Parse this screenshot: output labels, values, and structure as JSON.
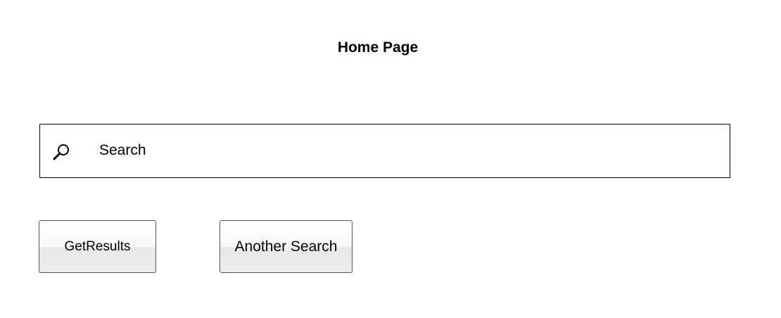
{
  "header": {
    "title": "Home Page"
  },
  "search": {
    "icon": "search-icon",
    "placeholder": "Search",
    "value": ""
  },
  "buttons": {
    "get_results_label": "GetResults",
    "another_search_label": "Another Search"
  },
  "colors": {
    "background": "#ffffff",
    "text": "#000000",
    "border": "#000000",
    "button_border": "#555555"
  }
}
